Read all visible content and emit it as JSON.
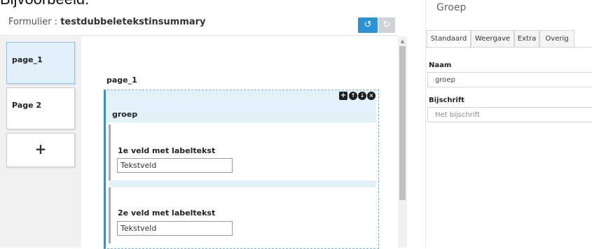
{
  "caption": "Bijvoorbeeld:",
  "header": {
    "form_label": "Formulier : ",
    "form_name": "testdubbeletekstinsummary",
    "undo_icon": "undo-icon",
    "redo_icon": "redo-icon"
  },
  "pages": {
    "items": [
      {
        "label": "page_1",
        "active": true
      },
      {
        "label": "Page 2",
        "active": false
      }
    ],
    "add_symbol": "+"
  },
  "canvas": {
    "page_title": "page_1",
    "group": {
      "title": "groep",
      "tools": {
        "add": "+",
        "up": "↑",
        "down": "↓",
        "remove": "×"
      },
      "fields": [
        {
          "label": "1e veld met labeltekst",
          "placeholder": "Tekstveld"
        },
        {
          "label": "2e veld met labeltekst",
          "placeholder": "Tekstveld"
        }
      ]
    }
  },
  "properties": {
    "title": "Groep",
    "tabs": [
      "Standaard",
      "Weergave",
      "Extra",
      "Overig"
    ],
    "name_label": "Naam",
    "name_value": "groep",
    "caption_label": "Bijschrift",
    "caption_placeholder": "Het bijschrift"
  },
  "colors": {
    "accent": "#2a93d5",
    "selected_bg": "#e1f0fb"
  }
}
